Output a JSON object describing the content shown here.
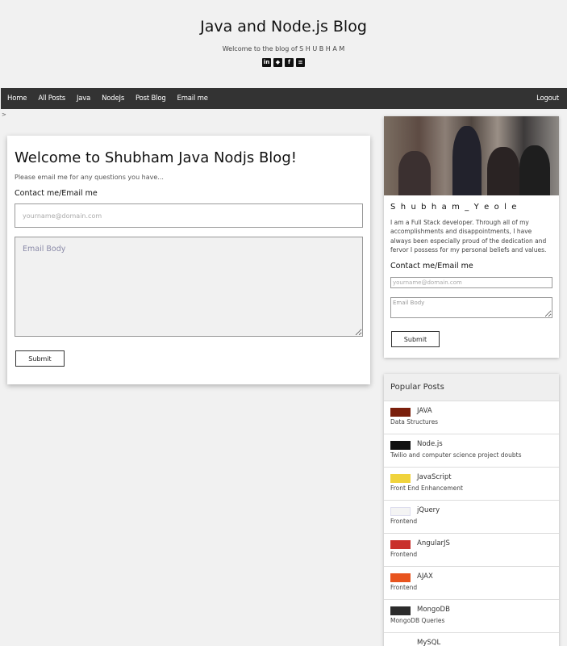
{
  "header": {
    "title": "Java and Node.js Blog",
    "subtitle": "Welcome to the blog of S H U B H A M",
    "socials": [
      {
        "icon": "linkedin-icon",
        "glyph": "in"
      },
      {
        "icon": "github-icon",
        "glyph": "◆"
      },
      {
        "icon": "facebook-icon",
        "glyph": "f"
      },
      {
        "icon": "stackoverflow-icon",
        "glyph": "≡"
      }
    ]
  },
  "nav": {
    "items": [
      "Home",
      "All Posts",
      "Java",
      "NodeJs",
      "Post Blog",
      "Email me"
    ],
    "logout": "Logout"
  },
  "breadcrumb": ">",
  "main": {
    "title": "Welcome to Shubham Java Nodjs Blog!",
    "description": "Please email me for any questions you have...",
    "contact_label": "Contact me/Email me",
    "email_placeholder": "yourname@domain.com",
    "body_placeholder": "Email Body",
    "submit_label": "Submit"
  },
  "sidebar": {
    "profile_name": "S h u b h a m _ Y e o l e",
    "bio": "I am a Full Stack developer. Through all of my accomplishments and disappointments, I have always been especially proud of the dedication and fervor I possess for my personal beliefs and values.",
    "contact_label": "Contact me/Email me",
    "email_placeholder": "yourname@domain.com",
    "body_placeholder": "Email Body",
    "submit_label": "Submit"
  },
  "popular": {
    "heading": "Popular Posts",
    "posts": [
      {
        "title": "JAVA",
        "subtitle": "Data Structures",
        "thumb_color": "#7a1f0c"
      },
      {
        "title": "Node.js",
        "subtitle": "Twilio and computer science project doubts",
        "thumb_color": "#111111"
      },
      {
        "title": "JavaScript",
        "subtitle": "Front End Enhancement",
        "thumb_color": "#f0d33c"
      },
      {
        "title": "jQuery",
        "subtitle": "Frontend",
        "thumb_color": "#f4f4f4"
      },
      {
        "title": "AngularJS",
        "subtitle": "Frontend",
        "thumb_color": "#c9302c"
      },
      {
        "title": "AJAX",
        "subtitle": "Frontend",
        "thumb_color": "#e8541e"
      },
      {
        "title": "MongoDB",
        "subtitle": "MongoDB Queries",
        "thumb_color": "#2b2b2b"
      },
      {
        "title": "MySQL",
        "subtitle": "",
        "thumb_color": "#ffffff"
      }
    ]
  }
}
